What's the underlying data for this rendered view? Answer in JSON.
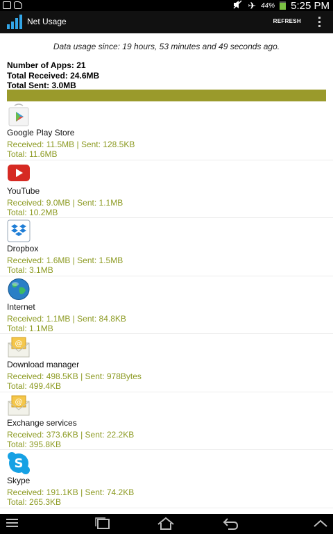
{
  "status_bar": {
    "battery_percent": "44%",
    "time": "5:25 PM",
    "icons": [
      "picture-icon",
      "sim-icon",
      "mute-icon",
      "airplane-icon",
      "battery-icon"
    ]
  },
  "action_bar": {
    "title": "Net Usage",
    "refresh_label": "REFRESH"
  },
  "summary": {
    "since": "Data usage since: 19 hours, 53 minutes and 49 seconds ago.",
    "apps": "Number of Apps: 21",
    "received": "Total Received: 24.6MB",
    "sent": "Total Sent: 3.0MB"
  },
  "apps": [
    {
      "name": "Google Play Store",
      "rs": "Received: 11.5MB | Sent: 128.5KB",
      "total": "Total: 11.6MB",
      "icon": "play-store-icon"
    },
    {
      "name": "YouTube",
      "rs": "Received: 9.0MB | Sent: 1.1MB",
      "total": "Total: 10.2MB",
      "icon": "youtube-icon"
    },
    {
      "name": "Dropbox",
      "rs": "Received: 1.6MB | Sent: 1.5MB",
      "total": "Total: 3.1MB",
      "icon": "dropbox-icon"
    },
    {
      "name": "Internet",
      "rs": "Received: 1.1MB | Sent: 84.8KB",
      "total": "Total: 1.1MB",
      "icon": "globe-icon"
    },
    {
      "name": "Download manager",
      "rs": "Received: 498.5KB | Sent: 978Bytes",
      "total": "Total: 499.4KB",
      "icon": "envelope-icon"
    },
    {
      "name": "Exchange services",
      "rs": "Received: 373.6KB | Sent: 22.2KB",
      "total": "Total: 395.8KB",
      "icon": "envelope-icon"
    },
    {
      "name": "Skype",
      "rs": "Received: 191.1KB | Sent: 74.2KB",
      "total": "Total: 265.3KB",
      "icon": "skype-icon"
    }
  ],
  "nav_icons": [
    "menu-icon",
    "recent-apps-icon",
    "home-icon",
    "back-icon",
    "chevron-up-icon"
  ],
  "colors": {
    "accent": "#8c9a22",
    "bar": "#9a9a2b"
  }
}
